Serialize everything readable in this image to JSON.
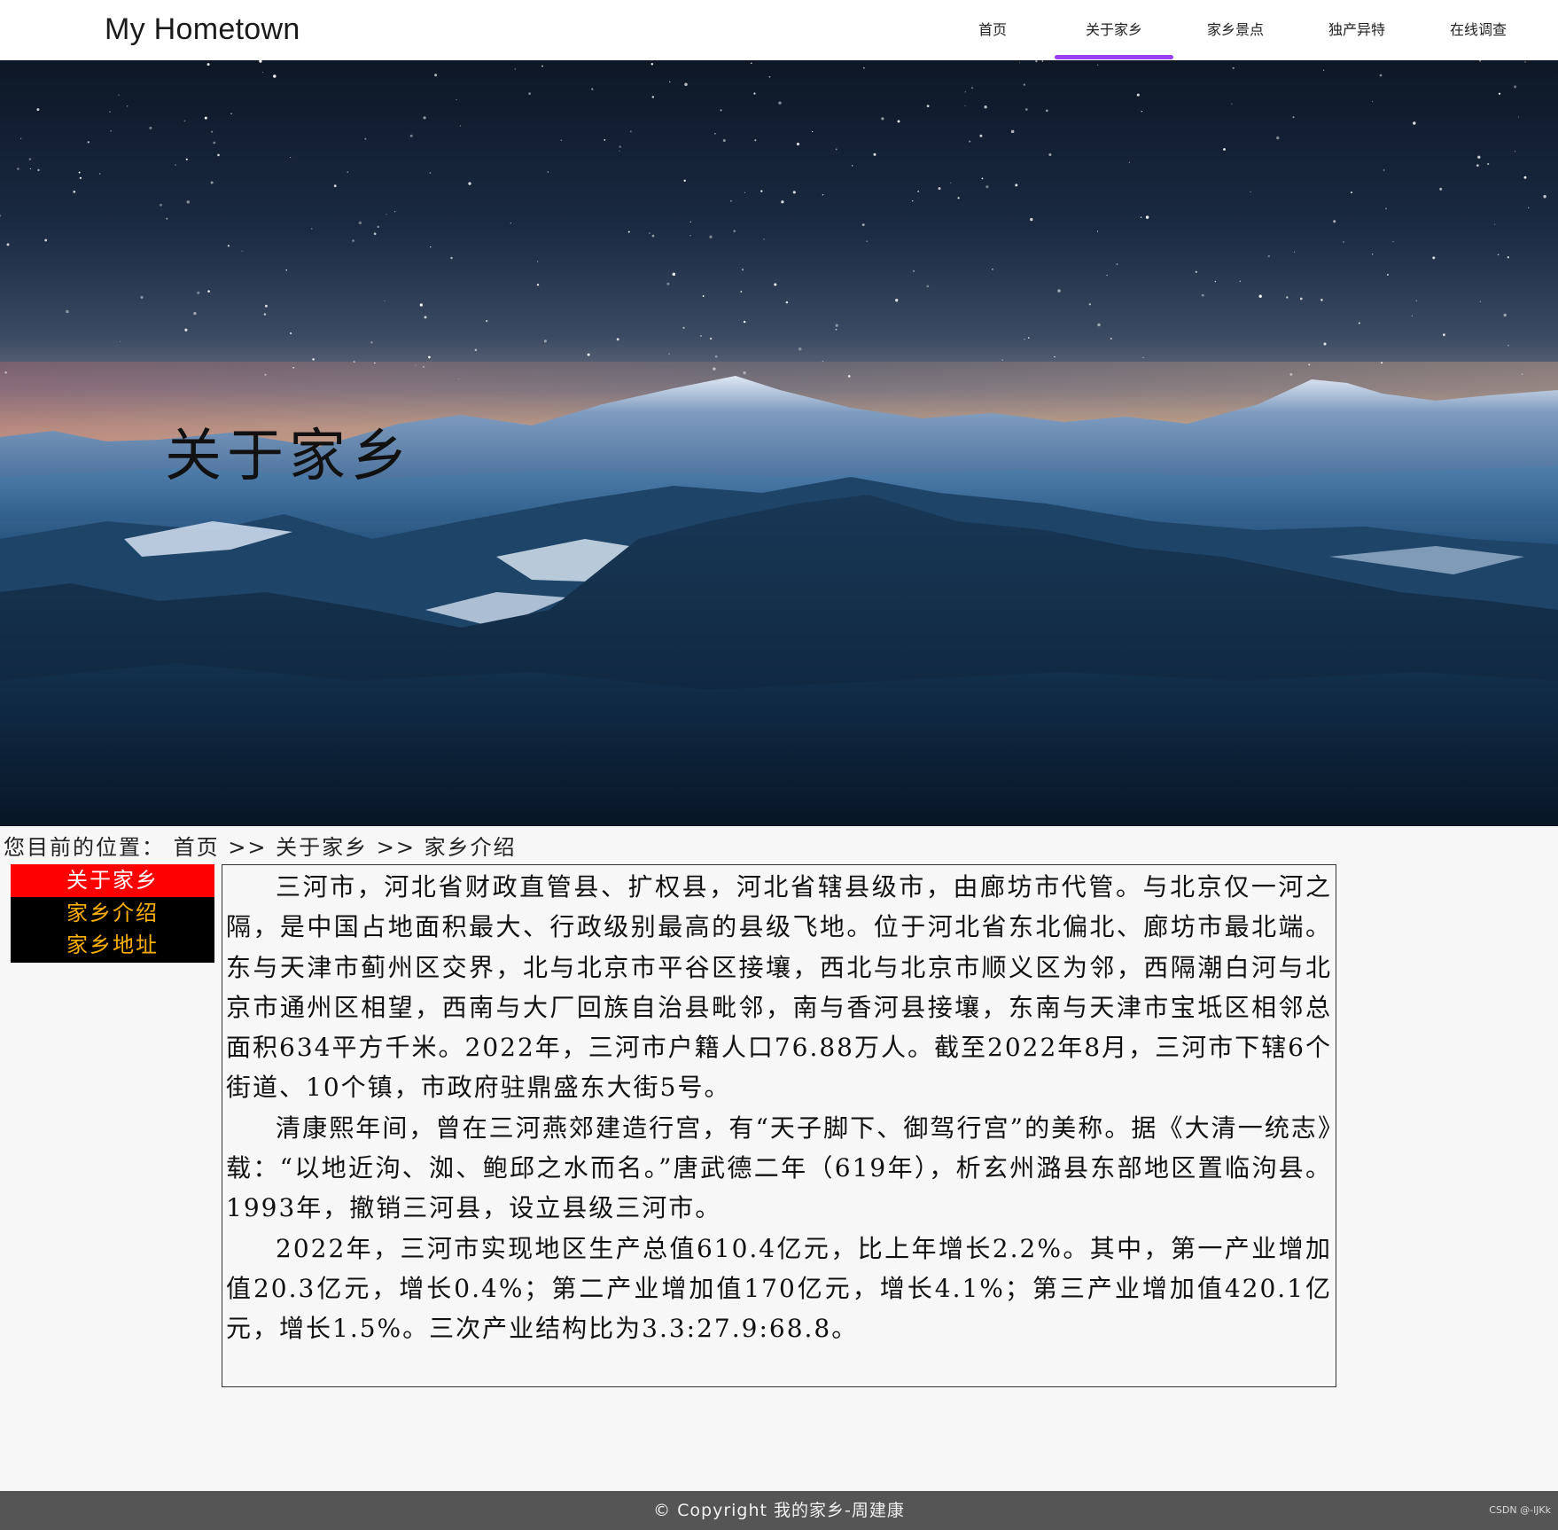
{
  "header": {
    "brand": "My Hometown",
    "nav": [
      {
        "label": "首页",
        "active": false
      },
      {
        "label": "关于家乡",
        "active": true
      },
      {
        "label": "家乡景点",
        "active": false
      },
      {
        "label": "独产异特",
        "active": false
      },
      {
        "label": "在线调查",
        "active": false
      }
    ],
    "active_color": "#9b3df0"
  },
  "hero": {
    "title": "关于家乡"
  },
  "breadcrumb": {
    "prefix": "您目前的位置：",
    "items": [
      "首页",
      "关于家乡",
      "家乡介绍"
    ],
    "separator": ">>"
  },
  "sidemenu": {
    "header": "关于家乡",
    "items": [
      "家乡介绍",
      "家乡地址"
    ],
    "header_bg": "#ff0000",
    "item_color": "#ffb000"
  },
  "content": {
    "paragraphs": [
      "三河市，河北省财政直管县、扩权县，河北省辖县级市，由廊坊市代管。与北京仅一河之隔，是中国占地面积最大、行政级别最高的县级飞地。位于河北省东北偏北、廊坊市最北端。东与天津市蓟州区交界，北与北京市平谷区接壤，西北与北京市顺义区为邻，西隔潮白河与北京市通州区相望，西南与大厂回族自治县毗邻，南与香河县接壤，东南与天津市宝坻区相邻总面积634平方千米。2022年，三河市户籍人口76.88万人。截至2022年8月，三河市下辖6个街道、10个镇，市政府驻鼎盛东大街5号。",
      "清康熙年间，曾在三河燕郊建造行宫，有“天子脚下、御驾行宫”的美称。据《大清一统志》载：“以地近泃、洳、鲍邱之水而名。”唐武德二年（619年），析玄州潞县东部地区置临泃县。1993年，撤销三河县，设立县级三河市。",
      "2022年，三河市实现地区生产总值610.4亿元，比上年增长2.2%。其中，第一产业增加值20.3亿元，增长0.4%；第二产业增加值170亿元，增长4.1%；第三产业增加值420.1亿元，增长1.5%。三次产业结构比为3.3:27.9:68.8。"
    ]
  },
  "footer": {
    "text": "© Copyright 我的家乡-周建康",
    "watermark": "CSDN @-lJKk"
  }
}
